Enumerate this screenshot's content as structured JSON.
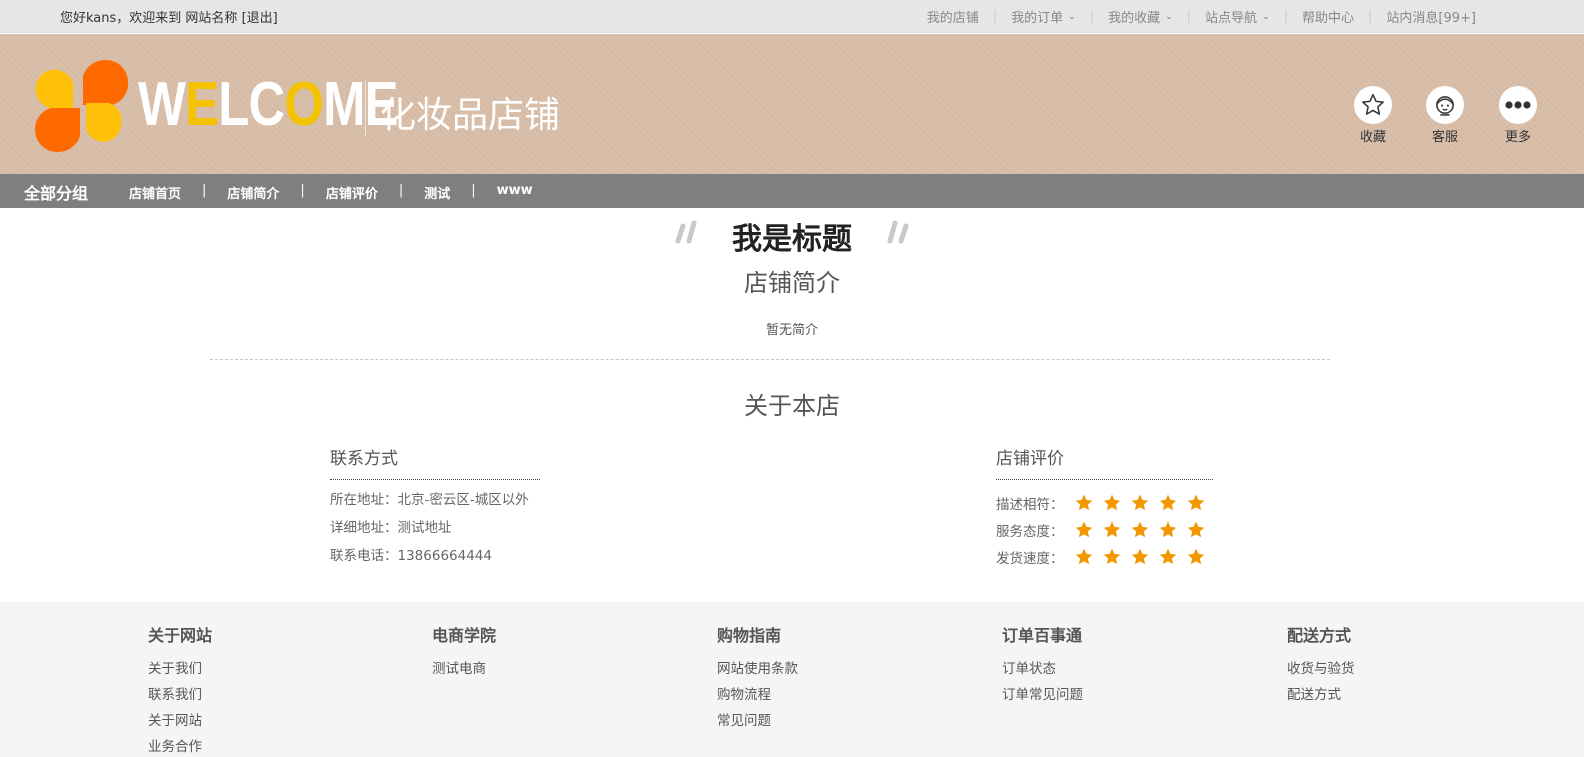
{
  "topbar": {
    "greeting": "您好kans，欢迎来到",
    "site_name": "网站名称",
    "logout": "[退出]",
    "links": [
      {
        "label": "我的店铺",
        "chevron": false
      },
      {
        "label": "我的订单",
        "chevron": true
      },
      {
        "label": "我的收藏",
        "chevron": true
      },
      {
        "label": "站点导航",
        "chevron": true
      },
      {
        "label": "帮助中心",
        "chevron": false
      },
      {
        "label": "站内消息[99+]",
        "chevron": false
      }
    ]
  },
  "banner": {
    "logo_text_parts": [
      "W",
      "E",
      "LC",
      "O",
      "ME"
    ],
    "store_name": "化妆品店铺",
    "actions": [
      {
        "label": "收藏",
        "icon": "star-outline-icon"
      },
      {
        "label": "客服",
        "icon": "customer-service-icon"
      },
      {
        "label": "更多",
        "icon": "more-dots-icon"
      }
    ],
    "colors": {
      "background": "#d9bea8",
      "accent_yellow": "#f4c300",
      "accent_orange": "#ff6a00"
    }
  },
  "navbar": {
    "all_groups": "全部分组",
    "links": [
      "店铺首页",
      "店铺简介",
      "店铺评价",
      "测试",
      "www"
    ]
  },
  "main": {
    "title": "我是标题",
    "intro_heading": "店铺简介",
    "intro_text": "暂无简介",
    "about_heading": "关于本店",
    "contact": {
      "heading": "联系方式",
      "address": "所在地址：北京-密云区-城区以外",
      "detail_address": "详细地址：测试地址",
      "phone": "联系电话：13866664444"
    },
    "rating": {
      "heading": "店铺评价",
      "items": [
        {
          "label": "描述相符：",
          "stars": 5
        },
        {
          "label": "服务态度：",
          "stars": 5
        },
        {
          "label": "发货速度：",
          "stars": 5
        }
      ],
      "star_color": "#f39800"
    }
  },
  "footer": {
    "columns": [
      {
        "heading": "关于网站",
        "links": [
          "关于我们",
          "联系我们",
          "关于网站",
          "业务合作"
        ]
      },
      {
        "heading": "电商学院",
        "links": [
          "测试电商"
        ]
      },
      {
        "heading": "购物指南",
        "links": [
          "网站使用条款",
          "购物流程",
          "常见问题"
        ]
      },
      {
        "heading": "订单百事通",
        "links": [
          "订单状态",
          "订单常见问题"
        ]
      },
      {
        "heading": "配送方式",
        "links": [
          "收货与验货",
          "配送方式"
        ]
      }
    ]
  }
}
